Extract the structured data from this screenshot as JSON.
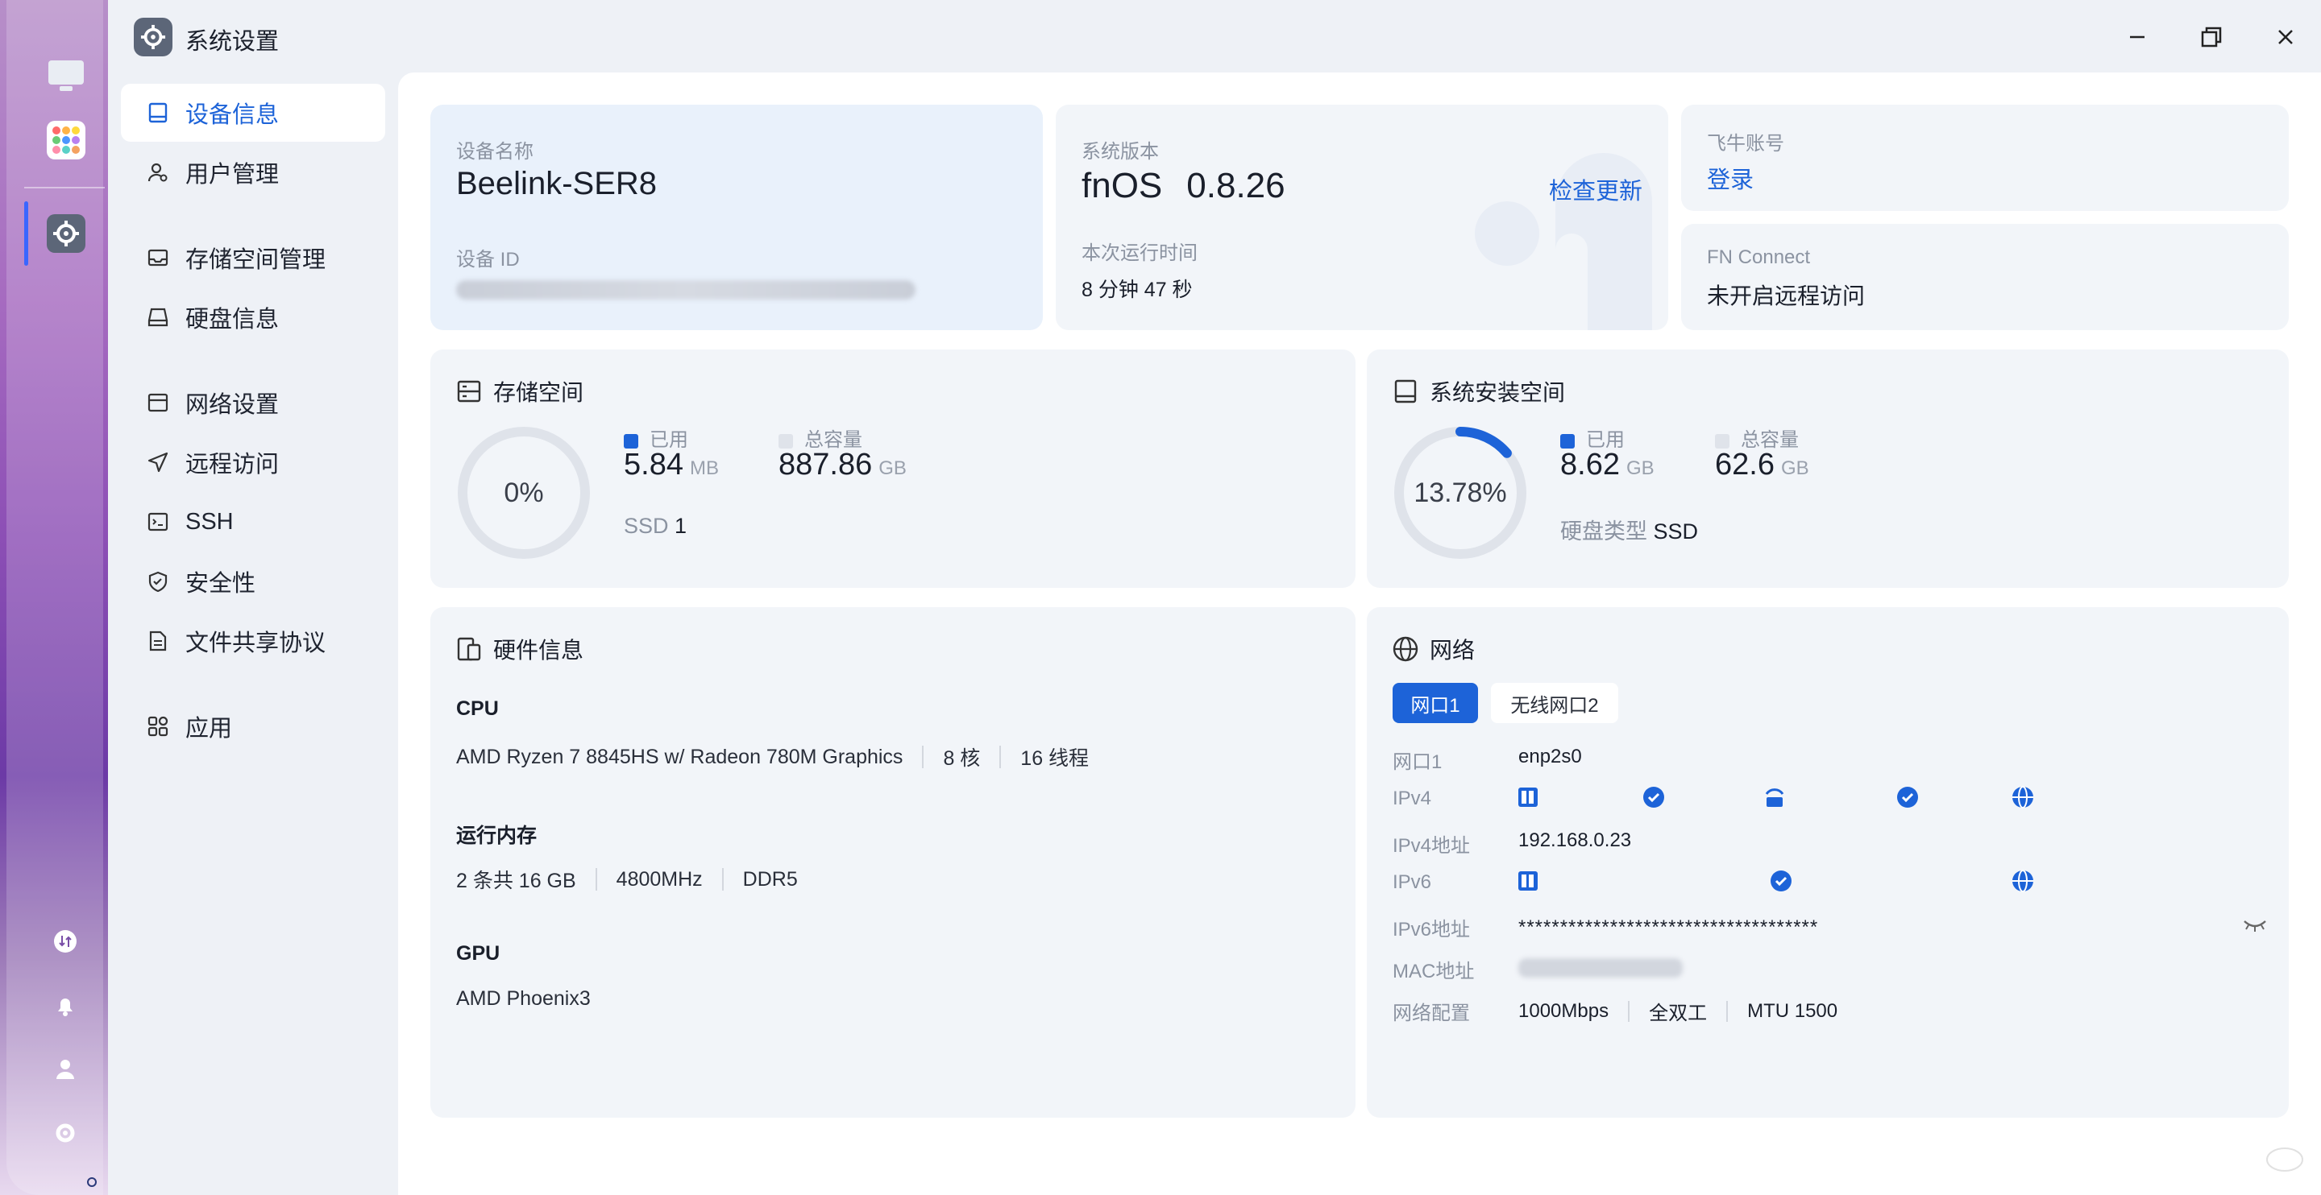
{
  "window": {
    "title": "系统设置"
  },
  "sidebar": {
    "items": [
      {
        "label": "设备信息",
        "icon": "device-icon"
      },
      {
        "label": "用户管理",
        "icon": "user-gear-icon"
      },
      {
        "label": "存储空间管理",
        "icon": "storage-icon"
      },
      {
        "label": "硬盘信息",
        "icon": "disk-icon"
      },
      {
        "label": "网络设置",
        "icon": "network-icon"
      },
      {
        "label": "远程访问",
        "icon": "send-icon"
      },
      {
        "label": "SSH",
        "icon": "terminal-icon"
      },
      {
        "label": "安全性",
        "icon": "shield-icon"
      },
      {
        "label": "文件共享协议",
        "icon": "document-icon"
      },
      {
        "label": "应用",
        "icon": "apps-icon"
      }
    ]
  },
  "device": {
    "name_label": "设备名称",
    "name": "Beelink-SER8",
    "id_label": "设备 ID"
  },
  "system": {
    "version_label": "系统版本",
    "os": "fnOS",
    "version": "0.8.26",
    "check_update": "检查更新",
    "uptime_label": "本次运行时间",
    "uptime": "8 分钟 47 秒"
  },
  "account": {
    "label": "飞牛账号",
    "login": "登录"
  },
  "fn_connect": {
    "label": "FN Connect",
    "status": "未开启远程访问"
  },
  "storage": {
    "title": "存储空间",
    "percent": "0%",
    "percent_value": 0,
    "used_label": "已用",
    "used": "5.84",
    "used_unit": "MB",
    "total_label": "总容量",
    "total": "887.86",
    "total_unit": "GB",
    "ssd_label": "SSD",
    "ssd_count": "1"
  },
  "system_space": {
    "title": "系统安装空间",
    "percent": "13.78%",
    "percent_value": 13.78,
    "used_label": "已用",
    "used": "8.62",
    "used_unit": "GB",
    "total_label": "总容量",
    "total": "62.6",
    "total_unit": "GB",
    "disk_type_label": "硬盘类型",
    "disk_type": "SSD"
  },
  "hardware": {
    "title": "硬件信息",
    "cpu_label": "CPU",
    "cpu_model": "AMD Ryzen 7 8845HS w/ Radeon 780M Graphics",
    "cpu_cores": "8 核",
    "cpu_threads": "16 线程",
    "ram_label": "运行内存",
    "ram_size": "2 条共 16 GB",
    "ram_speed": "4800MHz",
    "ram_type": "DDR5",
    "gpu_label": "GPU",
    "gpu_model": "AMD Phoenix3"
  },
  "network": {
    "title": "网络",
    "tabs": [
      "网口1",
      "无线网口2"
    ],
    "port_label": "网口1",
    "port_value": "enp2s0",
    "ipv4_label": "IPv4",
    "ipv4_addr_label": "IPv4地址",
    "ipv4_addr": "192.168.0.23",
    "ipv6_label": "IPv6",
    "ipv6_addr_label": "IPv6地址",
    "ipv6_addr": "************************************",
    "mac_label": "MAC地址",
    "config_label": "网络配置",
    "speed": "1000Mbps",
    "duplex": "全双工",
    "mtu": "MTU 1500"
  },
  "colors": {
    "accent": "#1d63d8",
    "card_bg": "#f2f5f9",
    "ring_bg": "#dfe3ea"
  }
}
